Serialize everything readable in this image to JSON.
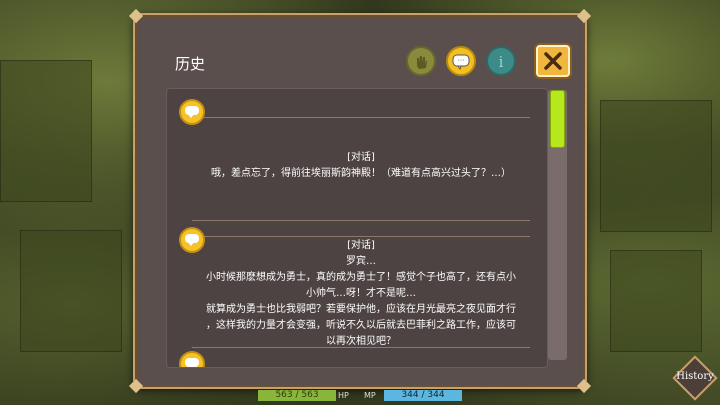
{
  "panel": {
    "title": "历史"
  },
  "toolbar": {
    "hand_icon": "hand-icon",
    "chat_icon": "chat-bubble-icon",
    "info_icon": "info-icon",
    "close_icon": "close-icon",
    "chat_icon_glyph": "···",
    "info_icon_glyph": "i",
    "close_icon_glyph": "✕"
  },
  "entries": [
    {
      "type_label": "[对话]",
      "lines": [
        "哦，差点忘了，得前往埃丽斯韵神殿！（难道有点高兴过头了？…）"
      ]
    },
    {
      "type_label": "[对话]",
      "lines": [
        "罗宾…",
        "小时候那麽想成为勇士，真的成为勇士了！感觉个子也高了，还有点小",
        "小帅气…呀！才不是呢…",
        "就算成为勇士也比我弱吧？若要保护他，应该在月光最亮之夜见面才行",
        "，这样我的力量才会变强，听说不久以后就去巴菲利之路工作，应该可",
        "以再次相见吧？"
      ]
    }
  ],
  "status": {
    "hp_value": "563 / 563",
    "hp_label": "HP",
    "mp_label": "MP",
    "mp_value": "344 / 344"
  },
  "history_button": {
    "label": "History"
  },
  "colors": {
    "panel_bg": "#5b4f4e",
    "border_gold": "#c9a06a",
    "scroll_thumb": "#b6e81b",
    "hp_bar": "#88b63a",
    "mp_bar": "#5bb7e0",
    "bubble_yellow": "#f5c328"
  }
}
